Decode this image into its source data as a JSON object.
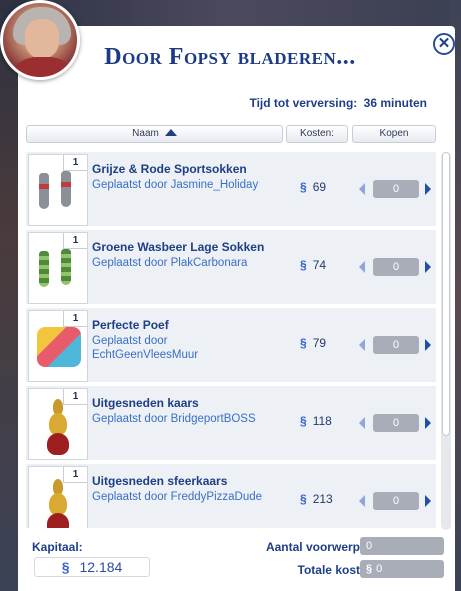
{
  "dialog": {
    "title": "Door Fopsy bladeren...",
    "close_icon": "close-icon",
    "refresh_label": "Tijd tot verversing:",
    "refresh_value": "36 minuten"
  },
  "columns": {
    "name": "Naam",
    "cost": "Kosten:",
    "buy": "Kopen"
  },
  "currency_symbol": "§",
  "items": [
    {
      "qty": "1",
      "name": "Grijze & Rode Sportsokken",
      "by": "Geplaatst door Jasmine_Holiday",
      "price": "69",
      "count": "0"
    },
    {
      "qty": "1",
      "name": "Groene Wasbeer Lage Sokken",
      "by": "Geplaatst door PlakCarbonara",
      "price": "74",
      "count": "0"
    },
    {
      "qty": "1",
      "name": "Perfecte Poef",
      "by": "Geplaatst door EchtGeenVleesMuur",
      "price": "79",
      "count": "0"
    },
    {
      "qty": "1",
      "name": "Uitgesneden kaars",
      "by": "Geplaatst door BridgeportBOSS",
      "price": "118",
      "count": "0"
    },
    {
      "qty": "1",
      "name": "Uitgesneden sfeerkaars",
      "by": "Geplaatst door FreddyPizzaDude",
      "price": "213",
      "count": "0"
    }
  ],
  "footer": {
    "capital_label": "Kapitaal:",
    "capital_value": "12.184",
    "item_count_label": "Aantal voorwerpen:",
    "item_count_value": "0",
    "total_label": "Totale kosten:",
    "total_value": "0"
  },
  "colors": {
    "accent": "#1e3f86",
    "link": "#3a6fc6",
    "row_bg": "#edf0f4"
  }
}
